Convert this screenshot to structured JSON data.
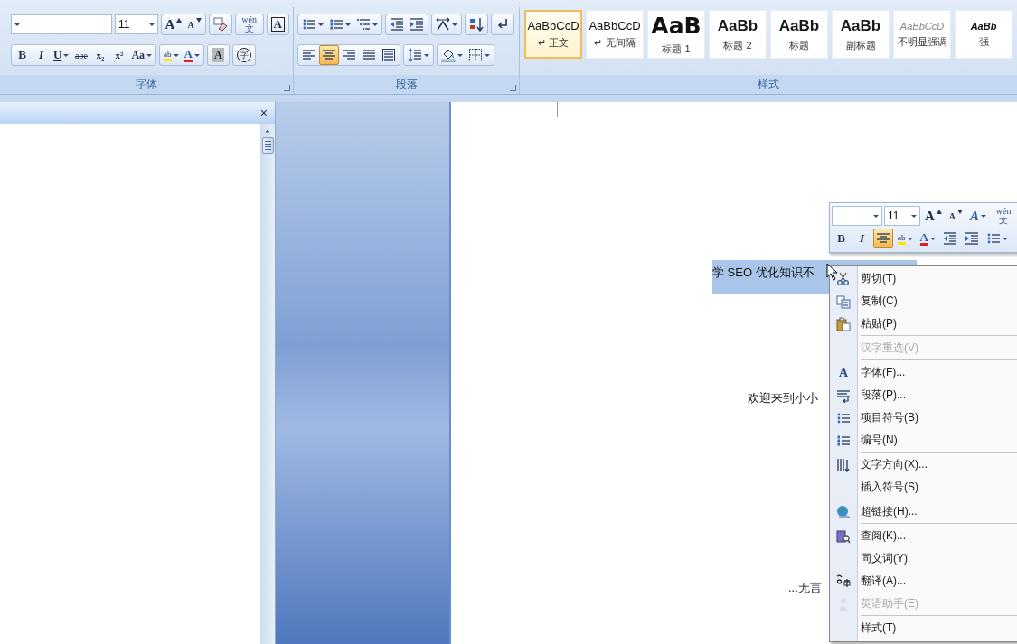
{
  "ribbon": {
    "font_group": {
      "label": "字体",
      "size_field": {
        "value": "11"
      },
      "row1": [
        {
          "buttons": [
            {
              "kind": "grow",
              "text": "A",
              "selected": false
            },
            {
              "kind": "shrink",
              "text": "A",
              "selected": false
            }
          ]
        },
        {
          "buttons": [
            {
              "kind": "clear",
              "selected": false
            }
          ]
        },
        {
          "buttons": [
            {
              "kind": "phonetic",
              "text": "wén 文",
              "selected": false
            }
          ]
        },
        {
          "buttons": [
            {
              "kind": "charborder",
              "text": "A",
              "selected": false
            }
          ]
        }
      ],
      "row2": [
        {
          "buttons": [
            {
              "kind": "bold",
              "text": "B",
              "selected": false
            },
            {
              "kind": "italic",
              "text": "I",
              "selected": false
            },
            {
              "kind": "underline",
              "text": "U",
              "selected": false
            },
            {
              "kind": "strike",
              "text": "abe",
              "selected": false
            },
            {
              "kind": "subscript",
              "text": "x₂",
              "selected": false
            },
            {
              "kind": "superscript",
              "text": "x²",
              "selected": false
            },
            {
              "kind": "case",
              "text": "Aa",
              "selected": false
            }
          ]
        },
        {
          "buttons": [
            {
              "kind": "highlight",
              "text": "ab",
              "selected": false
            },
            {
              "kind": "fontcolor",
              "text": "A",
              "selected": false
            }
          ]
        },
        {
          "buttons": [
            {
              "kind": "shading",
              "text": "A",
              "selected": false
            }
          ]
        },
        {
          "buttons": [
            {
              "kind": "enclose",
              "text": "字",
              "selected": false
            }
          ]
        }
      ]
    },
    "paragraph_group": {
      "label": "段落",
      "row1": [
        {
          "buttons": [
            {
              "kind": "bullets",
              "selected": false
            },
            {
              "kind": "numbering",
              "selected": false
            },
            {
              "kind": "multilevel",
              "selected": false
            }
          ]
        },
        {
          "buttons": [
            {
              "kind": "outdent",
              "selected": false
            },
            {
              "kind": "indent",
              "selected": false
            }
          ]
        },
        {
          "buttons": [
            {
              "kind": "asian",
              "selected": false
            }
          ]
        },
        {
          "buttons": [
            {
              "kind": "sort",
              "selected": false
            }
          ]
        },
        {
          "buttons": [
            {
              "kind": "marks",
              "selected": false
            }
          ]
        }
      ],
      "row2": [
        {
          "buttons": [
            {
              "kind": "alignleft",
              "selected": false
            },
            {
              "kind": "center",
              "selected": true
            },
            {
              "kind": "alignright",
              "selected": false
            },
            {
              "kind": "justify",
              "selected": false
            },
            {
              "kind": "distribute",
              "selected": false
            }
          ]
        },
        {
          "buttons": [
            {
              "kind": "linespacing",
              "selected": false
            }
          ]
        },
        {
          "buttons": [
            {
              "kind": "fill",
              "selected": false
            },
            {
              "kind": "borders",
              "selected": false
            }
          ]
        }
      ]
    },
    "styles_group": {
      "label": "样式",
      "styles": [
        {
          "kind": "normal",
          "sample": "AaBbCcD",
          "name": "↵ 正文",
          "selected": true
        },
        {
          "kind": "normal",
          "sample": "AaBbCcD",
          "name": "↵ 无间隔",
          "selected": false
        },
        {
          "kind": "heading1",
          "sample": "AaB",
          "name": "标题 1",
          "selected": false
        },
        {
          "kind": "heading2",
          "sample": "AaBb",
          "name": "标题 2",
          "selected": false
        },
        {
          "kind": "heading2",
          "sample": "AaBb",
          "name": "标题",
          "selected": false
        },
        {
          "kind": "heading2",
          "sample": "AaBb",
          "name": "副标题",
          "selected": false
        },
        {
          "kind": "subtle",
          "sample": "AaBbCcD",
          "name": "不明显强调",
          "selected": false
        },
        {
          "kind": "emphasis",
          "sample": "AaBb",
          "name": "强",
          "selected": false
        }
      ]
    }
  },
  "navigation_pane": {
    "close": "×"
  },
  "document": {
    "paragraphs": [
      {
        "text": "学 SEO 优化知识不",
        "selected": true
      },
      {
        "text": "欢迎来到小小",
        "selected": false
      },
      {
        "text": "...无言",
        "selected": false
      }
    ]
  },
  "mini_toolbar": {
    "size_field": {
      "value": "11"
    },
    "row1": [
      {
        "kind": "grow",
        "text": "A",
        "selected": false
      },
      {
        "kind": "shrink",
        "text": "A",
        "selected": false
      },
      {
        "kind": "styles",
        "text": "A",
        "selected": false
      },
      {
        "kind": "phonetic",
        "text": "wén 文",
        "selected": false
      }
    ],
    "row2": [
      {
        "kind": "bold",
        "text": "B",
        "selected": false
      },
      {
        "kind": "italic",
        "text": "I",
        "selected": false
      },
      {
        "kind": "center",
        "selected": true
      },
      {
        "kind": "highlight",
        "text": "ab",
        "selected": false
      },
      {
        "kind": "fontcolor",
        "text": "A",
        "selected": false
      },
      {
        "kind": "outdent",
        "selected": false
      },
      {
        "kind": "indent",
        "selected": false
      },
      {
        "kind": "bullets",
        "selected": false
      }
    ]
  },
  "context_menu": {
    "items": [
      {
        "kind": "cut",
        "label": "剪切(T)",
        "disabled": false
      },
      {
        "kind": "copy",
        "label": "复制(C)",
        "disabled": false
      },
      {
        "kind": "paste",
        "label": "粘贴(P)",
        "disabled": false
      },
      {
        "kind": "separator"
      },
      {
        "kind": "plain",
        "label": "汉字重选(V)",
        "disabled": true
      },
      {
        "kind": "separator"
      },
      {
        "kind": "font",
        "icon_text": "A",
        "label": "字体(F)...",
        "disabled": false
      },
      {
        "kind": "paragraph",
        "label": "段落(P)...",
        "disabled": false
      },
      {
        "kind": "bullets",
        "label": "项目符号(B)",
        "disabled": false
      },
      {
        "kind": "numbering",
        "label": "编号(N)",
        "disabled": false
      },
      {
        "kind": "separator"
      },
      {
        "kind": "textdir",
        "label": "文字方向(X)...",
        "disabled": false
      },
      {
        "kind": "plain",
        "label": "插入符号(S)",
        "disabled": false
      },
      {
        "kind": "separator"
      },
      {
        "kind": "globe",
        "label": "超链接(H)...",
        "disabled": false
      },
      {
        "kind": "separator"
      },
      {
        "kind": "research",
        "label": "查阅(K)...",
        "disabled": false
      },
      {
        "kind": "plain",
        "label": "同义词(Y)",
        "disabled": false
      },
      {
        "kind": "translate",
        "label": "翻译(A)...",
        "disabled": false
      },
      {
        "kind": "assistant",
        "label": "英语助手(E)",
        "disabled": true
      },
      {
        "kind": "separator"
      },
      {
        "kind": "plain",
        "label": "样式(T)",
        "disabled": false
      }
    ]
  }
}
